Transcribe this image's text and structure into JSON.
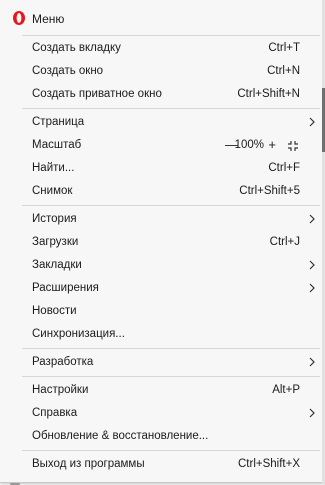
{
  "header": {
    "title": "Меню",
    "logo_icon": "opera-logo-icon",
    "logo_color": "#e5171f"
  },
  "items": [
    {
      "label": "Создать вкладку",
      "shortcut": "Ctrl+T"
    },
    {
      "label": "Создать окно",
      "shortcut": "Ctrl+N"
    },
    {
      "label": "Создать приватное окно",
      "shortcut": "Ctrl+Shift+N"
    },
    {
      "label": "Страница",
      "shortcut": ""
    },
    {
      "label": "Масштаб",
      "shortcut": ""
    },
    {
      "label": "Найти...",
      "shortcut": "Ctrl+F"
    },
    {
      "label": "Снимок",
      "shortcut": "Ctrl+Shift+5"
    },
    {
      "label": "История",
      "shortcut": ""
    },
    {
      "label": "Загрузки",
      "shortcut": "Ctrl+J"
    },
    {
      "label": "Закладки",
      "shortcut": ""
    },
    {
      "label": "Расширения",
      "shortcut": ""
    },
    {
      "label": "Новости",
      "shortcut": ""
    },
    {
      "label": "Синхронизация...",
      "shortcut": ""
    },
    {
      "label": "Разработка",
      "shortcut": ""
    },
    {
      "label": "Настройки",
      "shortcut": "Alt+P"
    },
    {
      "label": "Справка",
      "shortcut": ""
    },
    {
      "label": "Обновление & восстановление...",
      "shortcut": ""
    },
    {
      "label": "Выход из программы",
      "shortcut": "Ctrl+Shift+X"
    }
  ],
  "zoom": {
    "minus": "—",
    "value": "100%",
    "plus": "+",
    "fullscreen_icon": "fullscreen-icon"
  },
  "icons": {
    "submenu": "chevron-right-icon"
  },
  "colors": {
    "menu_bg": "#f7f7f7",
    "separator": "#d6d6d6",
    "text": "#1b1b1b"
  }
}
